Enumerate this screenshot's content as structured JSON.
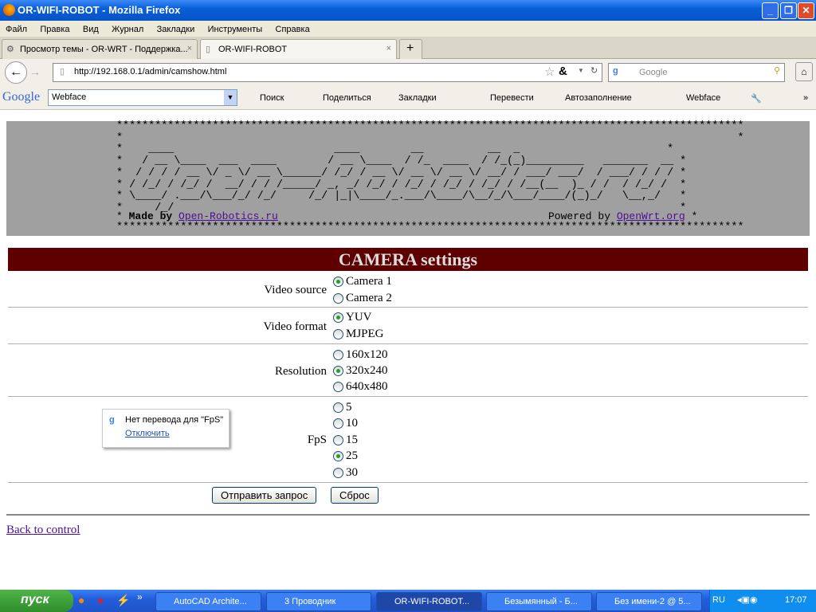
{
  "window": {
    "title": "OR-WIFI-ROBOT - Mozilla Firefox"
  },
  "menu": [
    "Файл",
    "Правка",
    "Вид",
    "Журнал",
    "Закладки",
    "Инструменты",
    "Справка"
  ],
  "tabs": [
    {
      "label": "Просмотр темы - OR-WRT - Поддержка..."
    },
    {
      "label": "OR-WIFI-ROBOT"
    }
  ],
  "nav": {
    "url": "http://192.168.0.1/admin/camshow.html",
    "search_placeholder": "Google"
  },
  "google_toolbar": {
    "logo": "Google",
    "query": "Webface",
    "items": [
      "Поиск",
      "Поделиться",
      "Закладки",
      "Перевести",
      "Автозаполнение",
      "Webface"
    ]
  },
  "banner": {
    "art": "**************************************************************************************************\n*                                                                                                *\n*    ____                         ____        __          __  _                       *\n*   / __ \\____  ___  ____        / __ \\____  / /_  ____  / /_(_)_________   _______  __ *\n*  / / / / __ \\/ _ \\/ __ \\______/ /_/ / __ \\/ __ \\/ __ \\/ __/ / ___/ ___/  / ___/ / / / *\n* / /_/ / /_/ /  __/ / / /_____/ _, _/ /_/ / /_/ / /_/ / /_/ / /__(__  )_ / /  / /_/ /  *\n* \\____/ .___/\\___/_/ /_/     /_/ |_|\\____/_.___/\\____/\\__/_/\\___/____/(_)_/   \\__,_/   *\n*     /_/                                                                               *",
    "made_by": "Made by",
    "made_by_link": "Open-Robotics.ru",
    "powered_by": "Powered by",
    "powered_by_link": "OpenWrt.org",
    "stars": "**************************************************************************************************"
  },
  "form": {
    "title": "CAMERA settings",
    "video_source": {
      "label": "Video source",
      "options": [
        "Camera 1",
        "Camera 2"
      ],
      "selected": 0
    },
    "video_format": {
      "label": "Video format",
      "options": [
        "YUV",
        "MJPEG"
      ],
      "selected": 0
    },
    "resolution": {
      "label": "Resolution",
      "options": [
        "160x120",
        "320x240",
        "640x480"
      ],
      "selected": 1
    },
    "fps": {
      "label": "FpS",
      "options": [
        "5",
        "10",
        "15",
        "25",
        "30"
      ],
      "selected": 3
    },
    "submit": "Отправить запрос",
    "reset": "Сброс"
  },
  "back_link": "Back to control",
  "translate_popup": {
    "text": "Нет перевода для \"FpS\"",
    "action": "Отключить"
  },
  "taskbar": {
    "start": "пуск",
    "tasks": [
      "AutoCAD Archite...",
      "3 Проводник",
      "OR-WIFI-ROBOT...",
      "Безымянный - Б...",
      "Без имени-2 @ 5..."
    ],
    "lang": "RU",
    "clock": "17:07"
  }
}
